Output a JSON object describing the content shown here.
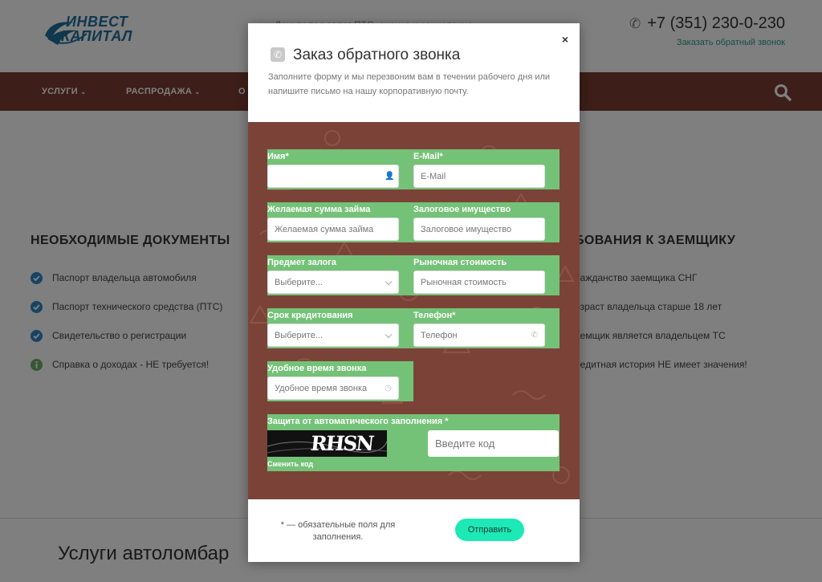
{
  "header": {
    "logo_line1": "ИНВЕСТ",
    "logo_line2": "КАПИТАЛ",
    "tagline": "Деньги под залог ПТС, оценка и зачисление",
    "phone": "+7 (351) 230-0-230",
    "callback_link": "Заказать обратный звонок"
  },
  "nav": {
    "items": [
      {
        "label": "Услуги",
        "chevron": true
      },
      {
        "label": "Распродажа",
        "chevron": true
      },
      {
        "label": "О",
        "chevron": false
      }
    ]
  },
  "documents": {
    "heading": "НЕОБХОДИМЫЕ ДОКУМЕНТЫ",
    "items": [
      {
        "text": "Паспорт владельца автомобиля",
        "icon": "check-circle-icon",
        "color": "#2f86c8"
      },
      {
        "text": "Паспорт технического средства (ПТС)",
        "icon": "check-circle-icon",
        "color": "#2f86c8"
      },
      {
        "text": "Свидетельство о регистрации",
        "icon": "check-circle-icon",
        "color": "#2f86c8"
      },
      {
        "text": "Справка о доходах - НЕ требуется!",
        "icon": "info-circle-icon",
        "color": "#6fae6a"
      }
    ]
  },
  "requirements": {
    "heading": "БОВАНИЯ К ЗАЕМЩИКУ",
    "items": [
      "ражданство заемщика СНГ",
      "озраст владельца старше 18 лет",
      "аемщик является владельцем ТС",
      "редитная история НЕ имеет значения!"
    ]
  },
  "services_title": "Услуги автоломбар",
  "modal": {
    "close": "×",
    "title": "Заказ обратного звонка",
    "description": "Заполните форму и мы перезвоним вам в течении рабочего дня или напишите письмо на нашу корпоративную почту.",
    "fields": {
      "name": {
        "label": "Имя*",
        "placeholder": ""
      },
      "email": {
        "label": "E-Mail*",
        "placeholder": "E-Mail"
      },
      "amount": {
        "label": "Желаемая сумма займа",
        "placeholder": "Желаемая сумма займа"
      },
      "collateral": {
        "label": "Залоговое имущество",
        "placeholder": "Залоговое имущество"
      },
      "subject": {
        "label": "Предмет залога",
        "value": "Выберите..."
      },
      "market_value": {
        "label": "Рыночная стоимость",
        "placeholder": "Рыночная стоимость"
      },
      "term": {
        "label": "Срок кредитования",
        "value": "Выберите..."
      },
      "phone": {
        "label": "Телефон*",
        "placeholder": "Телефон"
      },
      "call_time": {
        "label": "Удобное время звонка",
        "placeholder": "Удобное время звонка"
      }
    },
    "captcha": {
      "label": "Защита от автоматического заполнения *",
      "code_text": "RHSN",
      "change": "Сменить код",
      "placeholder": "Введите код"
    },
    "footer_note": "* — обязательные поля для заполнения.",
    "submit": "Отправить"
  },
  "colors": {
    "nav_bg": "#7a3d31",
    "form_bg": "#7b4338",
    "field_row": "#74c277",
    "submit": "#1de9b6"
  }
}
